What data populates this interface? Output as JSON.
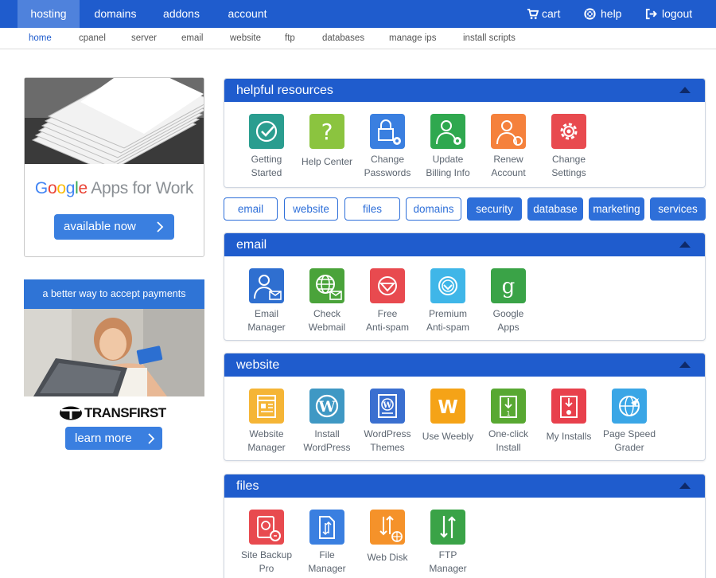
{
  "topnav": {
    "items": [
      {
        "label": "hosting",
        "active": true
      },
      {
        "label": "domains"
      },
      {
        "label": "addons"
      },
      {
        "label": "account"
      }
    ],
    "right": [
      {
        "label": "cart",
        "icon": "cart-icon"
      },
      {
        "label": "help",
        "icon": "lifebuoy-icon"
      },
      {
        "label": "logout",
        "icon": "logout-icon"
      }
    ]
  },
  "subnav": {
    "items": [
      "home",
      "cpanel",
      "server",
      "email",
      "website",
      "ftp",
      "databases",
      "manage ips",
      "install scripts"
    ]
  },
  "ads": {
    "google": {
      "brand": "Google",
      "product": "Apps for Work",
      "button": "available now"
    },
    "transfirst": {
      "banner": "a better way to accept payments",
      "brand": "TRANSFIRST",
      "button": "learn more"
    }
  },
  "filters": [
    {
      "label": "email",
      "active": false
    },
    {
      "label": "website",
      "active": false
    },
    {
      "label": "files",
      "active": false
    },
    {
      "label": "domains",
      "active": false
    },
    {
      "label": "security",
      "active": true
    },
    {
      "label": "database",
      "active": true
    },
    {
      "label": "marketing",
      "active": true
    },
    {
      "label": "services",
      "active": true
    }
  ],
  "panels": {
    "helpful": {
      "title": "helpful resources",
      "tiles": [
        {
          "label": "Getting Started",
          "l1": "Getting",
          "l2": "Started",
          "icon": "checkmark-icon",
          "color": "#2a9d8f"
        },
        {
          "label": "Help Center",
          "l1": "Help Center",
          "l2": "",
          "icon": "question-icon",
          "color": "#8bc43f"
        },
        {
          "label": "Change Passwords",
          "l1": "Change",
          "l2": "Passwords",
          "icon": "lock-gear-icon",
          "color": "#3a7fe0"
        },
        {
          "label": "Update Billing Info",
          "l1": "Update",
          "l2": "Billing Info",
          "icon": "user-gear-icon",
          "color": "#2fa84f"
        },
        {
          "label": "Renew Account",
          "l1": "Renew",
          "l2": "Account",
          "icon": "user-renew-icon",
          "color": "#f5813c"
        },
        {
          "label": "Change Settings",
          "l1": "Change",
          "l2": "Settings",
          "icon": "settings-gear-icon",
          "color": "#e84a4f"
        }
      ]
    },
    "email": {
      "title": "email",
      "tiles": [
        {
          "label": "Email Manager",
          "l1": "Email",
          "l2": "Manager",
          "icon": "user-mail-icon",
          "color": "#2f6fd0"
        },
        {
          "label": "Check Webmail",
          "l1": "Check",
          "l2": "Webmail",
          "icon": "globe-mail-icon",
          "color": "#4aa33a"
        },
        {
          "label": "Free Anti-spam",
          "l1": "Free",
          "l2": "Anti-spam",
          "icon": "shield-icon",
          "color": "#e84a4f"
        },
        {
          "label": "Premium Anti-spam",
          "l1": "Premium",
          "l2": "Anti-spam",
          "icon": "shield-premium-icon",
          "color": "#3fb6e8"
        },
        {
          "label": "Google Apps",
          "l1": "Google",
          "l2": "Apps",
          "icon": "google-g-icon",
          "color": "#3aa347"
        }
      ]
    },
    "website": {
      "title": "website",
      "tiles": [
        {
          "label": "Website Manager",
          "l1": "Website",
          "l2": "Manager",
          "icon": "webpage-icon",
          "color": "#f5b536"
        },
        {
          "label": "Install WordPress",
          "l1": "Install",
          "l2": "WordPress",
          "icon": "wordpress-icon",
          "color": "#3f98c4"
        },
        {
          "label": "WordPress Themes",
          "l1": "WordPress",
          "l2": "Themes",
          "icon": "wordpress-theme-icon",
          "color": "#3a6fd0"
        },
        {
          "label": "Use Weebly",
          "l1": "Use Weebly",
          "l2": "",
          "icon": "weebly-icon",
          "color": "#f5a317"
        },
        {
          "label": "One-click Install",
          "l1": "One-click",
          "l2": "Install",
          "icon": "install-icon",
          "color": "#58a832"
        },
        {
          "label": "My Installs",
          "l1": "My Installs",
          "l2": "",
          "icon": "installs-icon",
          "color": "#e8404c"
        },
        {
          "label": "Page Speed Grader",
          "l1": "Page Speed",
          "l2": "Grader",
          "icon": "speed-globe-icon",
          "color": "#3aa6e6"
        }
      ]
    },
    "files": {
      "title": "files",
      "tiles": [
        {
          "label": "Site Backup Pro",
          "l1": "Site Backup",
          "l2": "Pro",
          "icon": "backup-disk-icon",
          "color": "#e84a4f"
        },
        {
          "label": "File Manager",
          "l1": "File",
          "l2": "Manager",
          "icon": "file-manager-icon",
          "color": "#3a7fe0"
        },
        {
          "label": "Web Disk",
          "l1": "Web Disk",
          "l2": "",
          "icon": "web-disk-icon",
          "color": "#f5922a"
        },
        {
          "label": "FTP Manager",
          "l1": "FTP",
          "l2": "Manager",
          "icon": "ftp-arrows-icon",
          "color": "#3aa347"
        }
      ]
    }
  }
}
